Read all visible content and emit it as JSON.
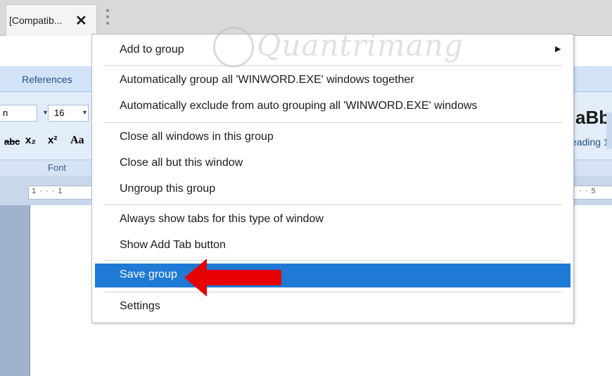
{
  "tab": {
    "title": "[Compatib...",
    "close_label": "✕"
  },
  "ribbon": {
    "tab_references": "References",
    "font_name": "n",
    "font_size": "16",
    "format_strike": "abc",
    "format_subscript": "x₂",
    "format_superscript": "x²",
    "format_change_case": "Aa",
    "group_font_label": "Font",
    "style_preview": "aBb(",
    "style_heading": "eading 1"
  },
  "ruler": {
    "left_text": "1 · · · 1",
    "right_text": "· · 5"
  },
  "watermark": {
    "text": "Quantrimang"
  },
  "menu": {
    "items": [
      {
        "label": "Add to group",
        "has_submenu": true
      },
      {
        "label": "Automatically group all 'WINWORD.EXE' windows together"
      },
      {
        "label": "Automatically exclude from auto grouping all 'WINWORD.EXE' windows"
      },
      {
        "label": "Close all windows in this group"
      },
      {
        "label": "Close all but this window"
      },
      {
        "label": "Ungroup this group"
      },
      {
        "label": "Always show tabs for this type of window"
      },
      {
        "label": "Show Add Tab button"
      },
      {
        "label": "Save group",
        "selected": true
      },
      {
        "label": "Settings"
      }
    ],
    "submenu_arrow": "▶"
  },
  "colors": {
    "selection": "#1e7ad4",
    "arrow": "#e60000",
    "ribbon": "#e3edf9"
  }
}
